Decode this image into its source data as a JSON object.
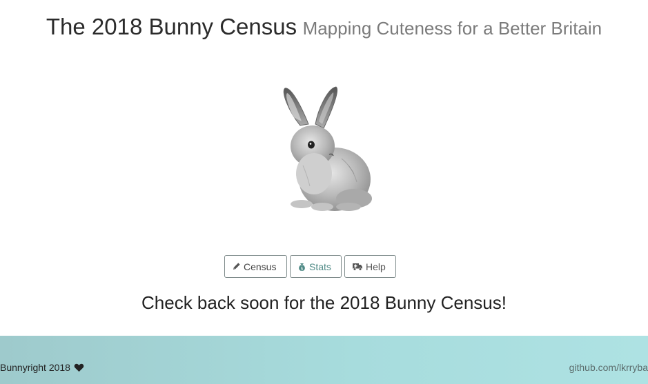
{
  "header": {
    "title": "The 2018 Bunny Census",
    "subtitle": "Mapping Cuteness for a Better Britain"
  },
  "hero": {
    "image_alt": "rabbit"
  },
  "buttons": [
    {
      "label": "Census",
      "icon": "pencil-icon"
    },
    {
      "label": "Stats",
      "icon": "money-bag-icon"
    },
    {
      "label": "Help",
      "icon": "ambulance-icon"
    }
  ],
  "main": {
    "message": "Check back soon for the 2018 Bunny Census!"
  },
  "footer": {
    "copyright": "Bunnyright 2018",
    "heart_icon": "heart-icon",
    "repo_link": "github.com/lkrryba"
  },
  "colors": {
    "footer_gradient_start": "#9ecacc",
    "footer_gradient_end": "#aee2e3",
    "stats_accent": "#4f8a86"
  }
}
